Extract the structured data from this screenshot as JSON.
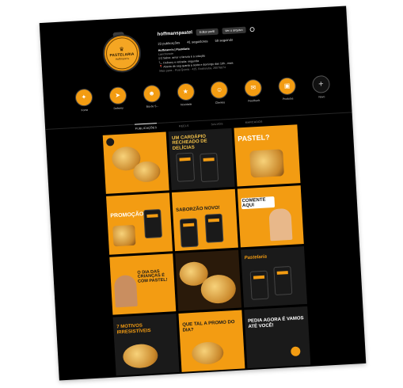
{
  "profile": {
    "username": "hoffmanspastel",
    "logo_crown": "♛",
    "logo_text": "PASTELARIA",
    "logo_sub": "Hoffmann's",
    "buttons": {
      "edit": "Editar perfil",
      "archive": "Ver o arquivo"
    },
    "stats": {
      "posts": "23 publicações",
      "followers": "41 seguidores",
      "following": "59 seguindo"
    },
    "bio": {
      "name": "Hoffmann's | Pastelaria",
      "category": "Lanchonete",
      "line1": "🍽 Sabor, amor e fartura é a solução",
      "line2": "📞 Delivery e retirada: segunda",
      "line3": "📍 Aberto de seg quarta a sexta e domingo das 18h...mais",
      "line4": "Mais para... Rua Quinta - 425, Bodroruba, 26076874"
    }
  },
  "highlights": [
    {
      "label": "Fome",
      "icon": "fork-icon"
    },
    {
      "label": "Delivery",
      "icon": "bike-icon"
    },
    {
      "label": "Bia de S...",
      "icon": "people-icon"
    },
    {
      "label": "Novidade",
      "icon": "star-icon"
    },
    {
      "label": "Clientes",
      "icon": "people-icon"
    },
    {
      "label": "Feedback",
      "icon": "chat-icon"
    },
    {
      "label": "Produtos",
      "icon": "bag-icon"
    },
    {
      "label": "Novo",
      "icon": "plus-icon"
    }
  ],
  "tabs": [
    "PUBLICAÇÕES",
    "REELS",
    "SALVOS",
    "MARCADOS"
  ],
  "posts": [
    {
      "caption": "",
      "bg": "#f39c12"
    },
    {
      "caption": "UM CARDÁPIO RECHEADO DE DELÍCIAS",
      "bg": "#1a1a1a"
    },
    {
      "caption": "PASTEL?",
      "bg": "#f39c12"
    },
    {
      "caption": "PROMOÇÃO",
      "bg": "#f39c12"
    },
    {
      "caption": "SABORZÃO NOVO!",
      "bg": "#f39c12"
    },
    {
      "caption": "COMENTE AQUI",
      "bg": "#f39c12"
    },
    {
      "caption": "O DIA DAS CRIANÇAS É COM PASTEL!",
      "bg": "#f39c12"
    },
    {
      "caption": "",
      "bg": "#2a1a0a"
    },
    {
      "caption": "Pastelaria",
      "bg": "#1a1a1a"
    },
    {
      "caption": "7 MOTIVOS IRRESISTÍVEIS",
      "bg": "#1a1a1a"
    },
    {
      "caption": "QUE TAL A PROMO DO DIA?",
      "bg": "#f39c12"
    },
    {
      "caption": "PEDIA AGORA É VAMOS ATÉ VOCÊ!",
      "bg": "#1a1a1a"
    }
  ],
  "colors": {
    "accent": "#f39c12",
    "background": "#000000"
  }
}
